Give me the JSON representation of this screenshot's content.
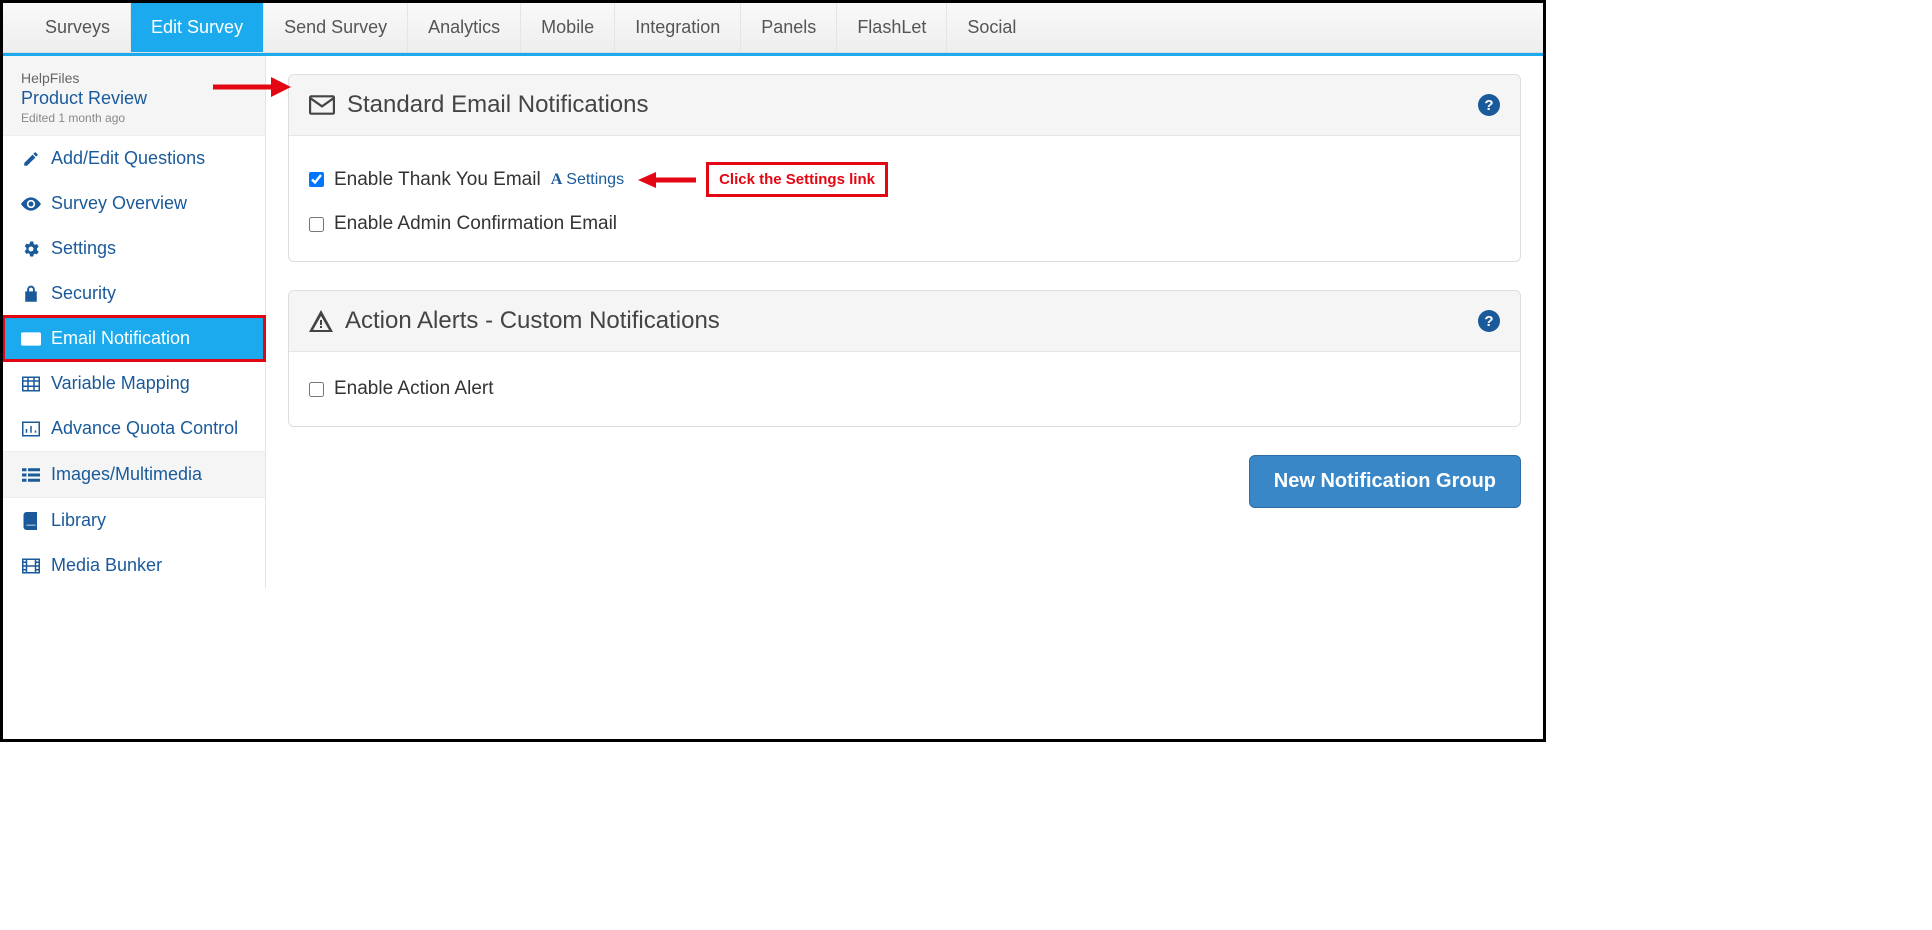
{
  "topnav": {
    "items": [
      {
        "label": "Surveys"
      },
      {
        "label": "Edit Survey",
        "active": true
      },
      {
        "label": "Send Survey"
      },
      {
        "label": "Analytics"
      },
      {
        "label": "Mobile"
      },
      {
        "label": "Integration"
      },
      {
        "label": "Panels"
      },
      {
        "label": "FlashLet"
      },
      {
        "label": "Social"
      }
    ]
  },
  "sidebar": {
    "header": {
      "helpfiles": "HelpFiles",
      "title": "Product Review",
      "edited": "Edited 1 month ago"
    },
    "items": [
      {
        "label": "Add/Edit Questions",
        "icon": "edit-icon"
      },
      {
        "label": "Survey Overview",
        "icon": "eye-icon"
      },
      {
        "label": "Settings",
        "icon": "gears-icon"
      },
      {
        "label": "Security",
        "icon": "lock-icon"
      },
      {
        "label": "Email Notification",
        "icon": "envelope-icon",
        "active": true,
        "highlighted": true
      },
      {
        "label": "Variable Mapping",
        "icon": "table-icon"
      },
      {
        "label": "Advance Quota Control",
        "icon": "barchart-icon"
      },
      {
        "label": "Images/Multimedia",
        "icon": "list-icon",
        "section": true
      },
      {
        "label": "Library",
        "icon": "book-icon"
      },
      {
        "label": "Media Bunker",
        "icon": "film-icon"
      }
    ]
  },
  "panels": {
    "standard": {
      "title": "Standard Email Notifications",
      "thankyou": {
        "label": "Enable Thank You Email",
        "checked": true,
        "settings_text": "Settings"
      },
      "admin": {
        "label": "Enable Admin Confirmation Email",
        "checked": false
      }
    },
    "alerts": {
      "title": "Action Alerts - Custom Notifications",
      "enable": {
        "label": "Enable Action Alert",
        "checked": false
      }
    }
  },
  "buttons": {
    "new_group": "New Notification Group"
  },
  "annotations": {
    "callout": "Click the Settings link"
  }
}
